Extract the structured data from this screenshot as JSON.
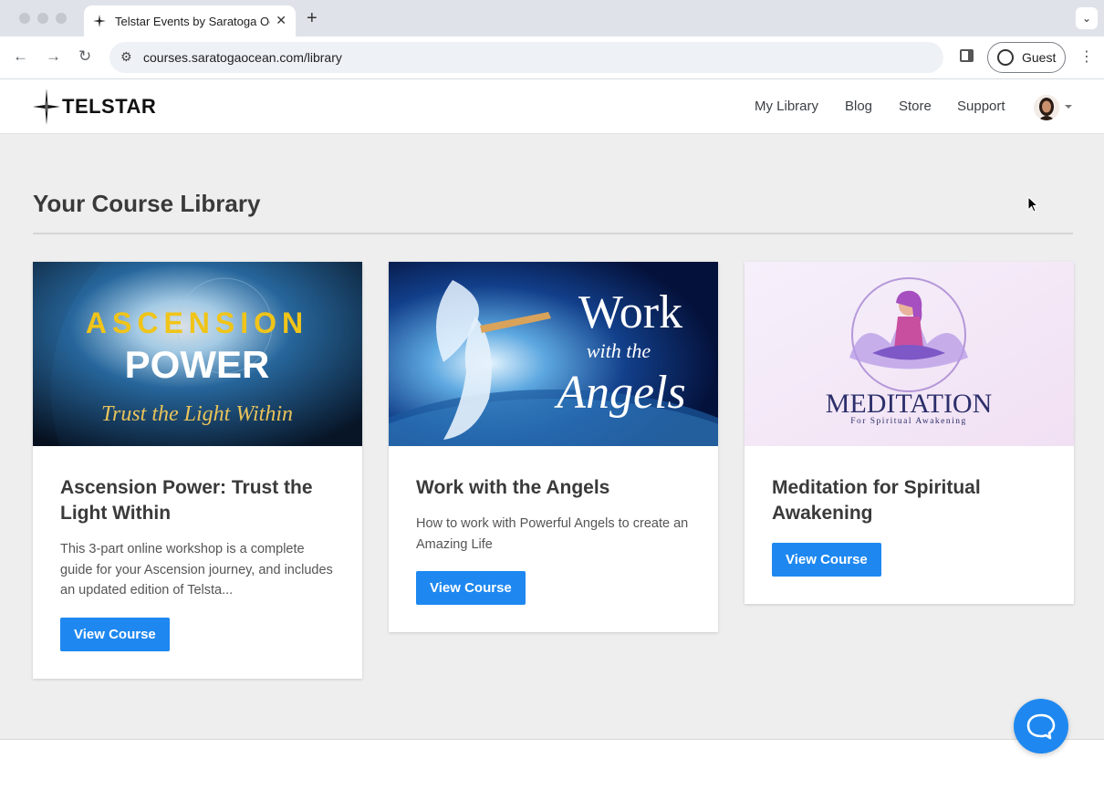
{
  "browser": {
    "tab_title": "Telstar Events by Saratoga Oc",
    "url": "courses.saratogaocean.com/library",
    "profile_label": "Guest"
  },
  "site": {
    "logo_text": "TELSTAR",
    "nav": [
      "My Library",
      "Blog",
      "Store",
      "Support"
    ]
  },
  "page": {
    "title": "Your Course Library"
  },
  "courses": [
    {
      "image_line1": "ASCENSION",
      "image_line2": "POWER",
      "image_line3": "Trust the Light Within",
      "title": "Ascension Power: Trust the Light Within",
      "description": "This 3-part online workshop is a complete guide for your Ascension journey, and includes an updated edition of Telsta...",
      "button": "View Course"
    },
    {
      "image_line1": "Work",
      "image_line2": "with the",
      "image_line3": "Angels",
      "title": "Work with the Angels",
      "description": "How to work with Powerful Angels to create an Amazing Life",
      "button": "View Course"
    },
    {
      "image_line1": "MEDITATION",
      "image_line2": "For Spiritual Awakening",
      "title": "Meditation for Spiritual Awakening",
      "button": "View Course"
    }
  ],
  "colors": {
    "accent": "#1e88f0",
    "page_bg": "#eeeeee"
  }
}
